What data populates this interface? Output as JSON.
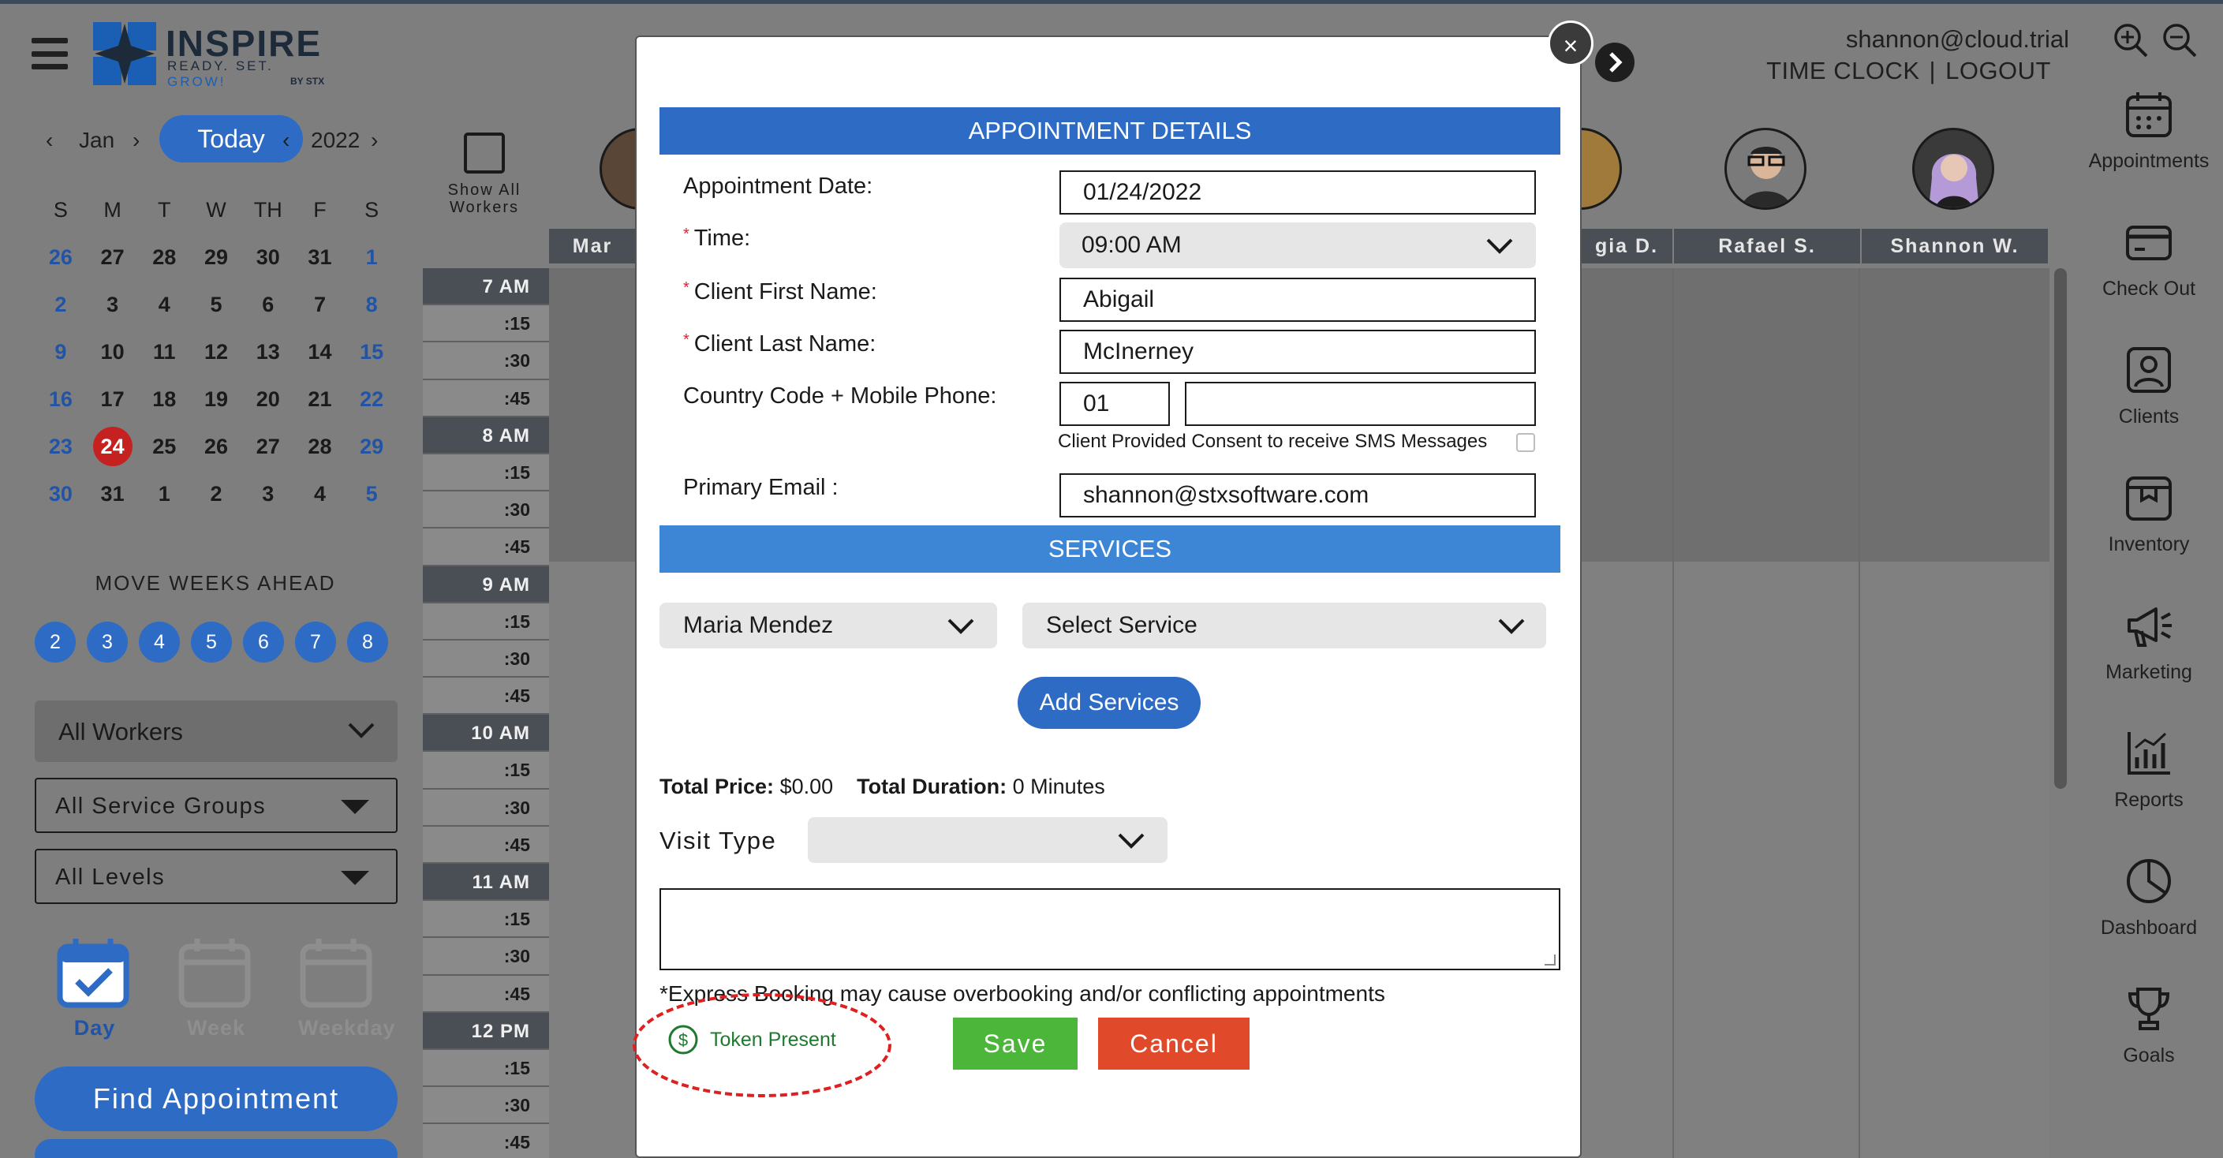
{
  "header": {
    "brand": "INSPIRE",
    "tagline_prefix": "READY. SET.",
    "tagline_accent": "GROW!",
    "brand_by": "BY STX",
    "user_email": "shannon@cloud.trial",
    "time_clock": "TIME CLOCK",
    "separator": "|",
    "logout": "LOGOUT"
  },
  "right_nav": [
    {
      "label": "Appointments",
      "icon": "calendar-icon"
    },
    {
      "label": "Check Out",
      "icon": "card-icon"
    },
    {
      "label": "Clients",
      "icon": "person-icon"
    },
    {
      "label": "Inventory",
      "icon": "box-icon"
    },
    {
      "label": "Marketing",
      "icon": "megaphone-icon"
    },
    {
      "label": "Reports",
      "icon": "bar-chart-icon"
    },
    {
      "label": "Dashboard",
      "icon": "pie-icon"
    },
    {
      "label": "Goals",
      "icon": "trophy-icon"
    }
  ],
  "calendar": {
    "month": "Jan",
    "today_label": "Today",
    "year": "2022",
    "day_headers": [
      "S",
      "M",
      "T",
      "W",
      "TH",
      "F",
      "S"
    ],
    "weeks": [
      [
        "26",
        "27",
        "28",
        "29",
        "30",
        "31",
        "1"
      ],
      [
        "2",
        "3",
        "4",
        "5",
        "6",
        "7",
        "8"
      ],
      [
        "9",
        "10",
        "11",
        "12",
        "13",
        "14",
        "15"
      ],
      [
        "16",
        "17",
        "18",
        "19",
        "20",
        "21",
        "22"
      ],
      [
        "23",
        "24",
        "25",
        "26",
        "27",
        "28",
        "29"
      ],
      [
        "30",
        "31",
        "1",
        "2",
        "3",
        "4",
        "5"
      ]
    ],
    "selected_day": "24",
    "move_weeks_title": "MOVE WEEKS AHEAD",
    "move_weeks": [
      "2",
      "3",
      "4",
      "5",
      "6",
      "7",
      "8"
    ]
  },
  "filters": {
    "workers": "All Workers",
    "service_groups": "All Service Groups",
    "levels": "All Levels"
  },
  "views": {
    "day": "Day",
    "week": "Week",
    "weekday": "Weekday"
  },
  "find_appointment": "Find Appointment",
  "schedule": {
    "show_all": "Show All Workers",
    "columns": [
      "Mar",
      "gia D.",
      "Rafael S.",
      "Shannon W."
    ],
    "times": [
      "7 AM",
      ":15",
      ":30",
      ":45",
      "8 AM",
      ":15",
      ":30",
      ":45",
      "9 AM",
      ":15",
      ":30",
      ":45",
      "10 AM",
      ":15",
      ":30",
      ":45",
      "11 AM",
      ":15",
      ":30",
      ":45",
      "12 PM",
      ":15",
      ":30",
      ":45"
    ]
  },
  "modal": {
    "close": "×",
    "details_title": "APPOINTMENT DETAILS",
    "date_label": "Appointment Date:",
    "date_value": "01/24/2022",
    "required_mark": "*",
    "time_label": "Time:",
    "time_value": "09:00 AM",
    "first_name_label": "Client First Name:",
    "first_name_value": "Abigail",
    "last_name_label": "Client Last Name:",
    "last_name_value": "McInerney",
    "phone_label": "Country Code + Mobile Phone:",
    "country_code": "01",
    "phone_value": "",
    "consent": "Client Provided Consent to receive SMS Messages",
    "email_label": "Primary Email :",
    "email_value": "shannon@stxsoftware.com",
    "services_title": "SERVICES",
    "worker_select": "Maria Mendez",
    "service_select": "Select Service",
    "add_services": "Add Services",
    "total_price_label": "Total Price:",
    "total_price": "$0.00",
    "total_duration_label": "Total Duration:",
    "total_duration": "0 Minutes",
    "visit_type_label": "Visit Type",
    "visit_type_value": "",
    "notes_value": "",
    "express_note": "*Express Booking may cause overbooking and/or conflicting appointments",
    "token_present": "Token Present",
    "save": "Save",
    "cancel": "Cancel"
  },
  "colors": {
    "primary_blue": "#2d6bc4",
    "save_green": "#4cb63a",
    "cancel_red": "#e0492a",
    "today_red": "#c62121",
    "token_green": "#1e7a2e"
  }
}
